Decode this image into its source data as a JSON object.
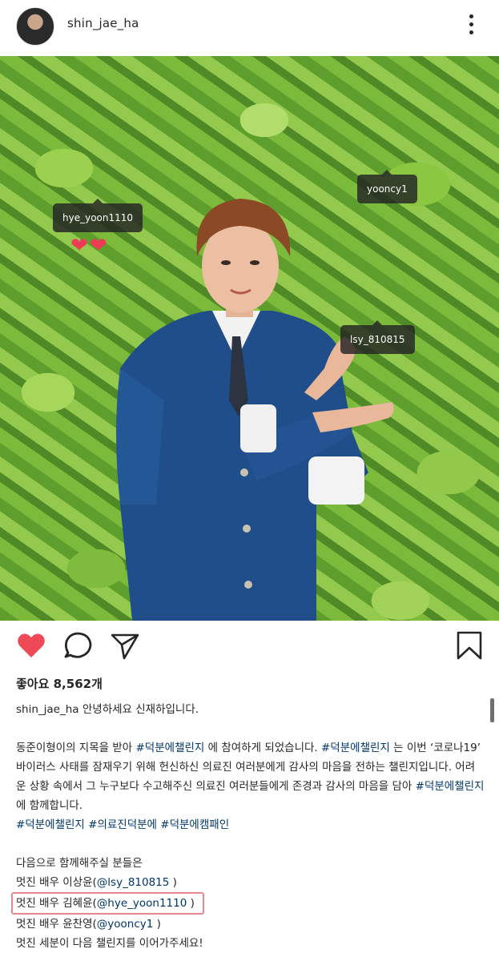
{
  "header": {
    "username": "shin_jae_ha",
    "avatar_icon": "profile-avatar",
    "more_icon": "more-vertical-icon"
  },
  "photo": {
    "tags": [
      {
        "label": "hye_yoon1110"
      },
      {
        "label": "yooncy1"
      },
      {
        "label": "lsy_810815"
      }
    ],
    "hearts": "❤❤",
    "user_tag_icon": "person-icon"
  },
  "actions": {
    "like_icon": "heart-filled-icon",
    "comment_icon": "comment-icon",
    "share_icon": "send-icon",
    "save_icon": "bookmark-icon",
    "like_color": "#ed4956"
  },
  "likes": {
    "text": "좋아요 8,562개"
  },
  "caption": {
    "author": "shin_jae_ha",
    "intro": "안녕하세요 신재하입니다.",
    "p1": {
      "t1": "동준이형이의 지목을 받아 ",
      "h1": "#덕분에챌린지",
      "t2": " 에 참여하게 되었습니다. ",
      "h2": "#덕분에챌린지",
      "t3": " 는 이번 ‘코로나19’ 바이러스 사태를 잠재우기 위해 헌신하신 의료진 여러분에게 감사의 마음을 전하는 챌린지입니다. 어려운 상황 속에서 그 누구보다 수고해주신 의료진 여러분들에게 존경과 감사의 마음을 담아 ",
      "h3": "#덕분에챌린지",
      "t4": " 에 함께합니다."
    },
    "tags_line": {
      "a": "#덕분에챌린지",
      "b": "#의료진덕분에",
      "c": "#덕분에캠패인"
    },
    "next_intro": "다음으로 함께해주실 분들은",
    "n1_pre": "멋진 배우 이상윤(",
    "n1_mention": "@lsy_810815",
    "n1_post": " )",
    "n2_pre": "멋진 배우 김혜윤(",
    "n2_mention": "@hye_yoon1110",
    "n2_post": " )",
    "n3_pre": "멋진 배우 윤찬영(",
    "n3_mention": "@yooncy1",
    "n3_post": " )",
    "closing": "멋진 세분이 다음 챌린지를 이어가주세요!"
  }
}
